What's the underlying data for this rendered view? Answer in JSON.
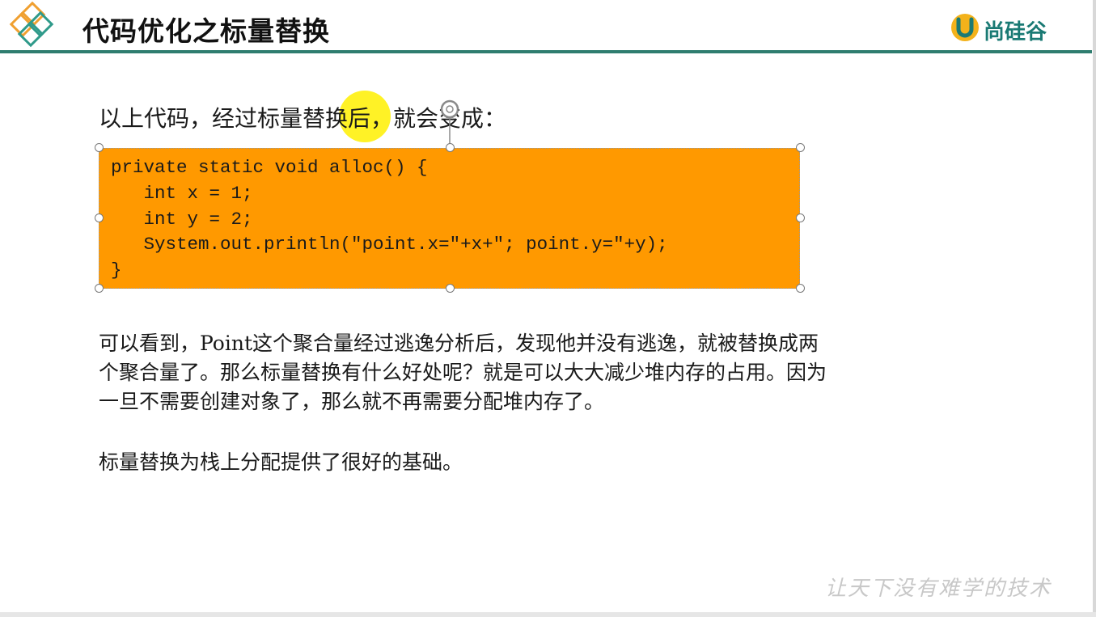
{
  "slide": {
    "title": "代码优化之标量替换",
    "brand_name": "尚硅谷",
    "intro_text": "以上代码，经过标量替换后，就会变成：",
    "code_lines": [
      "private static void alloc() {",
      "   int x = 1;",
      "   int y = 2;",
      "   System.out.println(\"point.x=\"+x+\"; point.y=\"+y);",
      "}"
    ],
    "paragraph_lines": [
      "可以看到，Point这个聚合量经过逃逸分析后，发现他并没有逃逸，就被替换成两",
      "个聚合量了。那么标量替换有什么好处呢？就是可以大大减少堆内存的占用。因为",
      "一旦不需要创建对象了，那么就不再需要分配堆内存了。"
    ],
    "summary_text": "标量替换为栈上分配提供了很好的基础。",
    "watermark": "让天下没有难学的技术"
  },
  "colors": {
    "code_box_fill": "#ff9900",
    "title_rule": "#2f7d6f",
    "brand": "#1a7a74",
    "cursor_highlight": "#fff000"
  },
  "icons": [
    "diamond-logo-icon",
    "brand-u-icon",
    "rotate-handle-icon"
  ]
}
